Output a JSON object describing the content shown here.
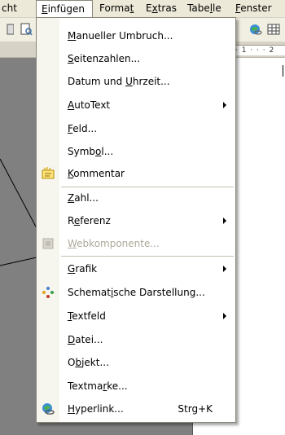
{
  "menubar": {
    "items": [
      {
        "id": "ansicht",
        "text": "cht"
      },
      {
        "id": "einfuegen",
        "pre": "",
        "acc": "E",
        "post": "infügen"
      },
      {
        "id": "format",
        "pre": "Forma",
        "acc": "t",
        "post": ""
      },
      {
        "id": "extras",
        "pre": "E",
        "acc": "x",
        "post": "tras"
      },
      {
        "id": "tabelle",
        "pre": "Tabe",
        "acc": "l",
        "post": "le"
      },
      {
        "id": "fenster",
        "pre": "",
        "acc": "F",
        "post": "enster"
      }
    ]
  },
  "ruler": {
    "text": "· 1 · · · 2"
  },
  "menu": {
    "items": [
      {
        "pre": "",
        "acc": "M",
        "post": "anueller Umbruch...",
        "icon": "",
        "submenu": false,
        "shortcut": "",
        "disabled": false
      },
      {
        "pre": "",
        "acc": "S",
        "post": "eitenzahlen...",
        "icon": "",
        "submenu": false,
        "shortcut": "",
        "disabled": false
      },
      {
        "pre": "Datum und ",
        "acc": "U",
        "post": "hrzeit...",
        "icon": "",
        "submenu": false,
        "shortcut": "",
        "disabled": false
      },
      {
        "pre": "",
        "acc": "A",
        "post": "utoText",
        "icon": "",
        "submenu": true,
        "shortcut": "",
        "disabled": false
      },
      {
        "pre": "",
        "acc": "F",
        "post": "eld...",
        "icon": "",
        "submenu": false,
        "shortcut": "",
        "disabled": false
      },
      {
        "pre": "Symb",
        "acc": "o",
        "post": "l...",
        "icon": "",
        "submenu": false,
        "shortcut": "",
        "disabled": false
      },
      {
        "pre": "",
        "acc": "K",
        "post": "ommentar",
        "icon": "comment-icon",
        "submenu": false,
        "shortcut": "",
        "disabled": false
      },
      {
        "pre": "",
        "acc": "Z",
        "post": "ahl...",
        "icon": "",
        "submenu": false,
        "shortcut": "",
        "disabled": false
      },
      {
        "pre": "R",
        "acc": "e",
        "post": "ferenz",
        "icon": "",
        "submenu": true,
        "shortcut": "",
        "disabled": false
      },
      {
        "pre": "",
        "acc": "W",
        "post": "ebkomponente...",
        "icon": "web-component-icon",
        "submenu": false,
        "shortcut": "",
        "disabled": true
      },
      {
        "pre": "",
        "acc": "G",
        "post": "rafik",
        "icon": "",
        "submenu": true,
        "shortcut": "",
        "disabled": false
      },
      {
        "pre": "Schemat",
        "acc": "i",
        "post": "sche Darstellung...",
        "icon": "diagram-icon",
        "submenu": false,
        "shortcut": "",
        "disabled": false
      },
      {
        "pre": "",
        "acc": "T",
        "post": "extfeld",
        "icon": "",
        "submenu": true,
        "shortcut": "",
        "disabled": false
      },
      {
        "pre": "",
        "acc": "D",
        "post": "atei...",
        "icon": "",
        "submenu": false,
        "shortcut": "",
        "disabled": false
      },
      {
        "pre": "O",
        "acc": "b",
        "post": "jekt...",
        "icon": "",
        "submenu": false,
        "shortcut": "",
        "disabled": false
      },
      {
        "pre": "Textma",
        "acc": "r",
        "post": "ke...",
        "icon": "",
        "submenu": false,
        "shortcut": "",
        "disabled": false
      },
      {
        "pre": "",
        "acc": "H",
        "post": "yperlink...",
        "icon": "hyperlink-icon",
        "submenu": false,
        "shortcut": "Strg+K",
        "disabled": false
      }
    ]
  },
  "colors": {
    "menubar_bg": "#ece9d8",
    "menu_gutter": "#f6f6ee",
    "disabled_text": "#aca899",
    "doc_background": "#808080"
  }
}
